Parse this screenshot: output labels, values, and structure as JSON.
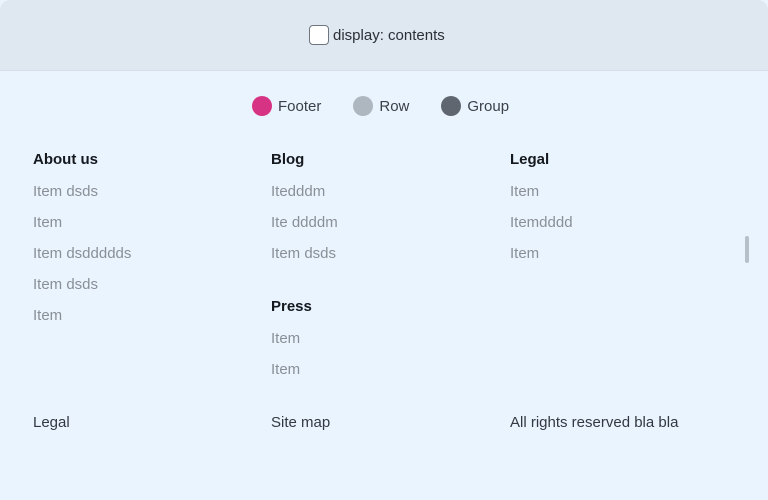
{
  "topbar": {
    "toggle_label": "display: contents"
  },
  "legend": {
    "items": [
      {
        "label": "Footer",
        "color": "#d63384"
      },
      {
        "label": "Row",
        "color": "#aeb6bf"
      },
      {
        "label": "Group",
        "color": "#5f6670"
      }
    ]
  },
  "columns": [
    {
      "title": "About us",
      "items": [
        "Item dsds",
        "Item",
        "Item dsddddds",
        "Item dsds",
        "Item"
      ]
    },
    {
      "title": "Blog",
      "items": [
        "Itedddm",
        "Ite ddddm",
        "Item dsds"
      ],
      "press_title": "Press",
      "press_items": [
        "Item",
        "Item"
      ]
    },
    {
      "title": "Legal",
      "items": [
        "Item",
        "Itemdddd",
        "Item"
      ]
    }
  ],
  "bottom_row": [
    "Legal",
    "Site map",
    "All rights reserved bla bla"
  ]
}
